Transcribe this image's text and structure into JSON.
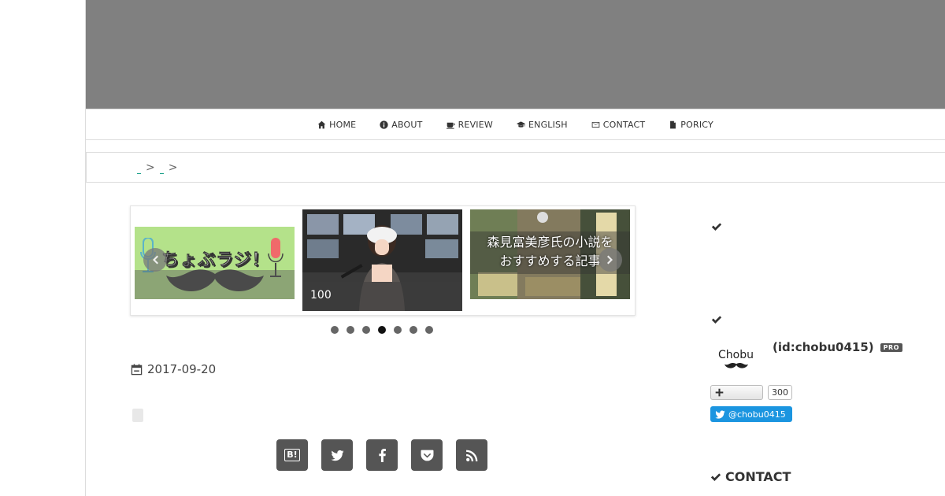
{
  "nav": {
    "items": [
      {
        "label": "HOME",
        "icon": "home-icon"
      },
      {
        "label": "ABOUT",
        "icon": "info-circle-icon"
      },
      {
        "label": "REVIEW",
        "icon": "coffee-icon"
      },
      {
        "label": "ENGLISH",
        "icon": "graduation-cap-icon"
      },
      {
        "label": "CONTACT",
        "icon": "envelope-icon"
      },
      {
        "label": "PORICY",
        "icon": "file-icon"
      }
    ]
  },
  "breadcrumb": {
    "separator": ">"
  },
  "carousel": {
    "slides": [
      {
        "caption": "ちょぶラジ！"
      },
      {
        "caption": "100"
      },
      {
        "caption": "森見富美彦氏の小説をおすすめする記事"
      }
    ],
    "slide3_lines": [
      "森見富美彦氏の小説を",
      "おすすめする記事"
    ],
    "dot_count": 7,
    "active_dot": 3
  },
  "post": {
    "date": "2017-09-20"
  },
  "share": {
    "buttons": [
      {
        "label": "B!",
        "icon": "hatena-bookmark-icon"
      },
      {
        "label": "",
        "icon": "twitter-icon"
      },
      {
        "label": "",
        "icon": "facebook-icon"
      },
      {
        "label": "",
        "icon": "pocket-icon"
      },
      {
        "label": "",
        "icon": "rss-icon"
      }
    ]
  },
  "sidebar": {
    "profile": {
      "logo_text": "Chobu",
      "id_text": "(id:chobu0415)",
      "badge": "PRO",
      "follower_count": "300",
      "twitter_handle": "@chobu0415"
    },
    "contact_heading": "CONTACT"
  },
  "colors": {
    "header_band": "#808080",
    "twitter_blue": "#1b95e0",
    "share_button": "#555555",
    "breadcrumb_link": "#1aa08a"
  }
}
